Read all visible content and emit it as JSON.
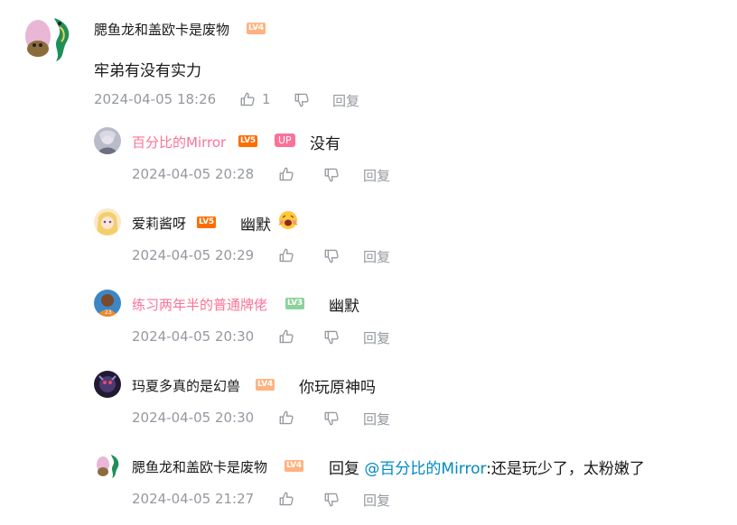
{
  "main_comment": {
    "username": "腮鱼龙和盖欧卡是废物",
    "level": "LV4",
    "text": "牢弟有没有实力",
    "time": "2024-04-05 18:26",
    "likes": "1",
    "reply_label": "回复"
  },
  "replies": [
    {
      "username": "百分比的Mirror",
      "level": "LV5",
      "up_badge": "UP",
      "text": "没有",
      "time": "2024-04-05 20:28",
      "reply_label": "回复"
    },
    {
      "username": "爱莉酱呀",
      "level": "LV5",
      "text": "幽默",
      "time": "2024-04-05 20:29",
      "reply_label": "回复"
    },
    {
      "username": "练习两年半的普通牌佬",
      "level": "LV3",
      "text": "幽默",
      "time": "2024-04-05 20:30",
      "reply_label": "回复"
    },
    {
      "username": "玛夏多真的是幻兽",
      "level": "LV4",
      "text": "你玩原神吗",
      "time": "2024-04-05 20:30",
      "reply_label": "回复"
    },
    {
      "username": "腮鱼龙和盖欧卡是废物",
      "level": "LV4",
      "text_prefix": "回复",
      "mention": "@百分比的Mirror",
      "text_suffix": ":还是玩少了，太粉嫩了",
      "time": "2024-04-05 21:27",
      "reply_label": "回复"
    }
  ],
  "colors": {
    "meta_gray": "#9499a0",
    "vip_pink": "#fb7299",
    "mention_blue": "#008ac5"
  },
  "icons": [
    "thumbs-up-icon",
    "thumbs-down-icon",
    "laughing-emoji-icon"
  ]
}
